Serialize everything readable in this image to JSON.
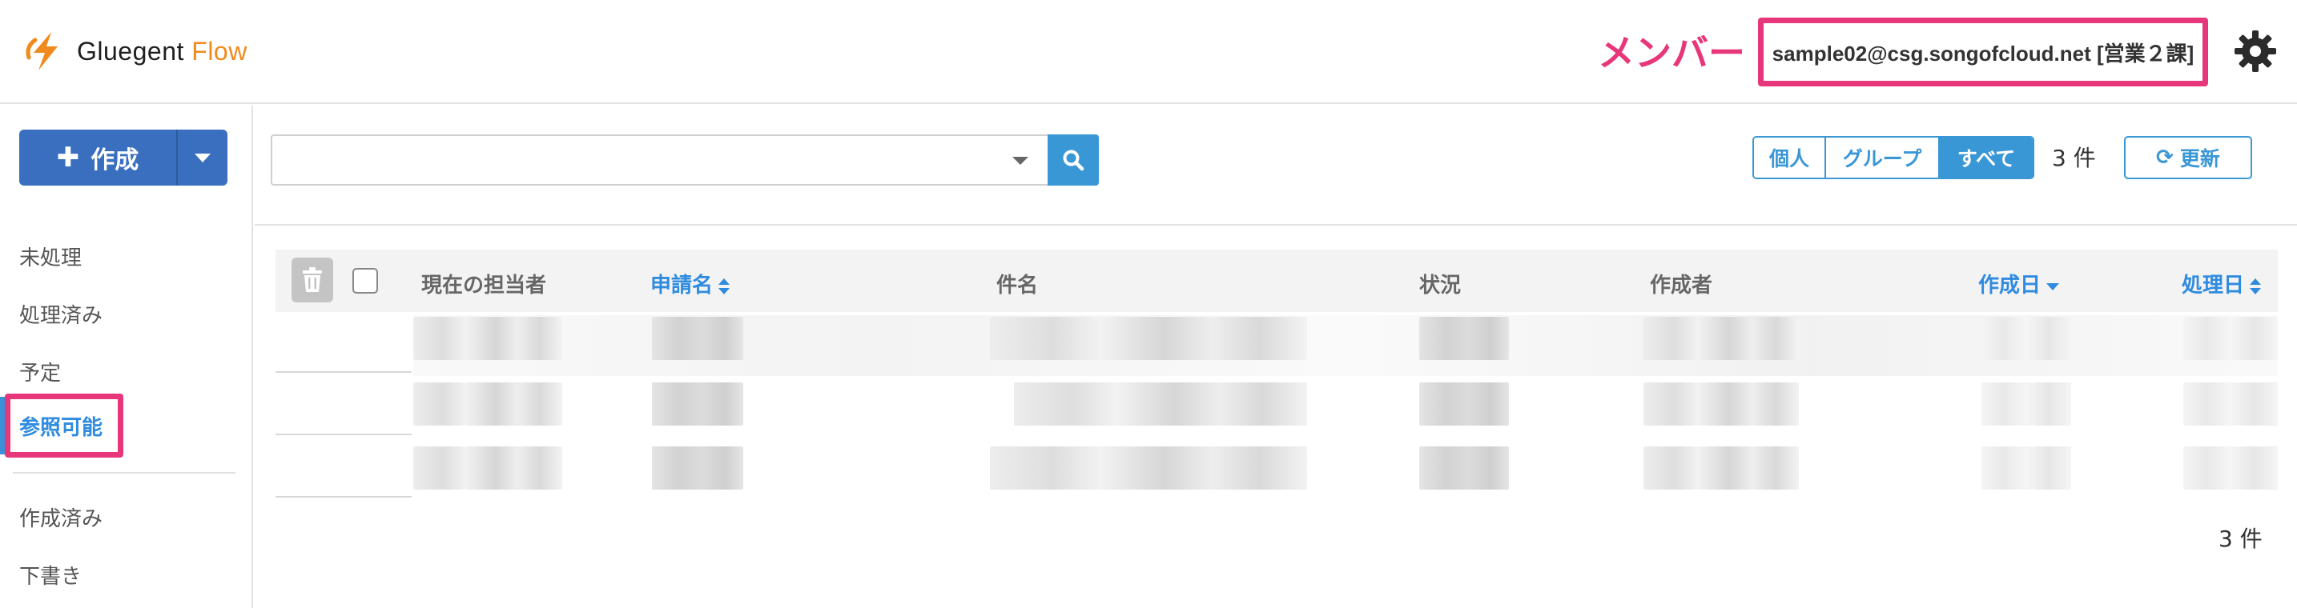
{
  "app": {
    "brand_part1": "Gluegent",
    "brand_part2": "Flow"
  },
  "header": {
    "annotation_label": "メンバー",
    "user": "sample02@csg.songofcloud.net [営業２課]",
    "accent_color": "#e8367a"
  },
  "sidebar": {
    "create_label": "作成",
    "items": [
      "未処理",
      "処理済み",
      "予定",
      "参照可能",
      "作成済み",
      "下書き"
    ],
    "active_item": "参照可能"
  },
  "toolbar": {
    "search_placeholder": "",
    "filters": [
      "個人",
      "グループ",
      "すべて"
    ],
    "active_filter": "すべて",
    "count": "3 件",
    "refresh_label": "更新"
  },
  "table": {
    "columns": [
      "現在の担当者",
      "申請名",
      "件名",
      "状況",
      "作成者",
      "作成日",
      "処理日"
    ],
    "sortable_columns": [
      "申請名",
      "作成日",
      "処理日"
    ],
    "row_count": 3
  },
  "footer": {
    "count": "3 件"
  },
  "icons": {
    "search": "search-icon",
    "settings": "gear-icon",
    "refresh": "refresh-icon",
    "trash": "trash-icon"
  },
  "colors": {
    "primary": "#3a6fc0",
    "link": "#3a97d6",
    "brand_orange": "#f08a1c"
  }
}
